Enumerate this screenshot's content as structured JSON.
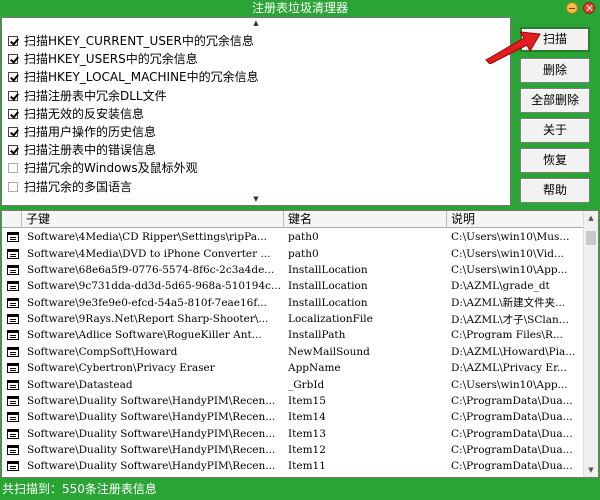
{
  "window": {
    "title": "注册表垃圾清理器"
  },
  "options": [
    {
      "label": "扫描HKEY_CURRENT_USER中的冗余信息",
      "checked": true
    },
    {
      "label": "扫描HKEY_USERS中的冗余信息",
      "checked": true
    },
    {
      "label": "扫描HKEY_LOCAL_MACHINE中的冗余信息",
      "checked": true
    },
    {
      "label": "扫描注册表中冗余DLL文件",
      "checked": true
    },
    {
      "label": "扫描无效的反安装信息",
      "checked": true
    },
    {
      "label": "扫描用户操作的历史信息",
      "checked": true
    },
    {
      "label": "扫描注册表中的错误信息",
      "checked": true
    },
    {
      "label": "扫描冗余的Windows及鼠标外观",
      "checked": false
    },
    {
      "label": "扫描冗余的多国语言",
      "checked": false
    }
  ],
  "buttons": {
    "scan": "扫描",
    "delete": "删除",
    "delete_all": "全部删除",
    "about": "关于",
    "restore": "恢复",
    "help": "帮助"
  },
  "table": {
    "headers": [
      "子键",
      "键名",
      "说明"
    ],
    "rows": [
      [
        "Software\\4Media\\CD Ripper\\Settings\\ripPa...",
        "path0",
        "C:\\Users\\win10\\Mus..."
      ],
      [
        "Software\\4Media\\DVD to iPhone Converter ...",
        "path0",
        "C:\\Users\\win10\\Vid..."
      ],
      [
        "Software\\68e6a5f9-0776-5574-8f6c-2c3a4de...",
        "InstallLocation",
        "C:\\Users\\win10\\App..."
      ],
      [
        "Software\\9c731dda-dd3d-5d65-968a-510194c...",
        "InstallLocation",
        "D:\\AZML\\grade_dt"
      ],
      [
        "Software\\9e3fe9e0-efcd-54a5-810f-7eae16f...",
        "InstallLocation",
        "D:\\AZML\\新建文件夹..."
      ],
      [
        "Software\\9Rays.Net\\Report Sharp-Shooter\\...",
        "LocalizationFile",
        "D:\\AZML\\才子\\SClan..."
      ],
      [
        "Software\\Adlice Software\\RogueKiller Ant...",
        "InstallPath",
        "C:\\Program Files\\R..."
      ],
      [
        "Software\\CompSoft\\Howard",
        "NewMailSound",
        "D:\\AZML\\Howard\\Pia..."
      ],
      [
        "Software\\Cybertron\\Privacy Eraser",
        "AppName",
        "D:\\AZML\\Privacy Er..."
      ],
      [
        "Software\\Datastead",
        "_GrbId",
        "C:\\Users\\win10\\App..."
      ],
      [
        "Software\\Duality Software\\HandyPIM\\Recen...",
        "Item15",
        "C:\\ProgramData\\Dua..."
      ],
      [
        "Software\\Duality Software\\HandyPIM\\Recen...",
        "Item14",
        "C:\\ProgramData\\Dua..."
      ],
      [
        "Software\\Duality Software\\HandyPIM\\Recen...",
        "Item13",
        "C:\\ProgramData\\Dua..."
      ],
      [
        "Software\\Duality Software\\HandyPIM\\Recen...",
        "Item12",
        "C:\\ProgramData\\Dua..."
      ],
      [
        "Software\\Duality Software\\HandyPIM\\Recen...",
        "Item11",
        "C:\\ProgramData\\Dua..."
      ]
    ]
  },
  "status": {
    "text": "共扫描到：550条注册表信息"
  },
  "colors": {
    "frame": "#2aa535",
    "arrow": "#e02020"
  },
  "icons": {
    "row": "registry-key-icon",
    "arrow": "red-arrow-icon"
  }
}
